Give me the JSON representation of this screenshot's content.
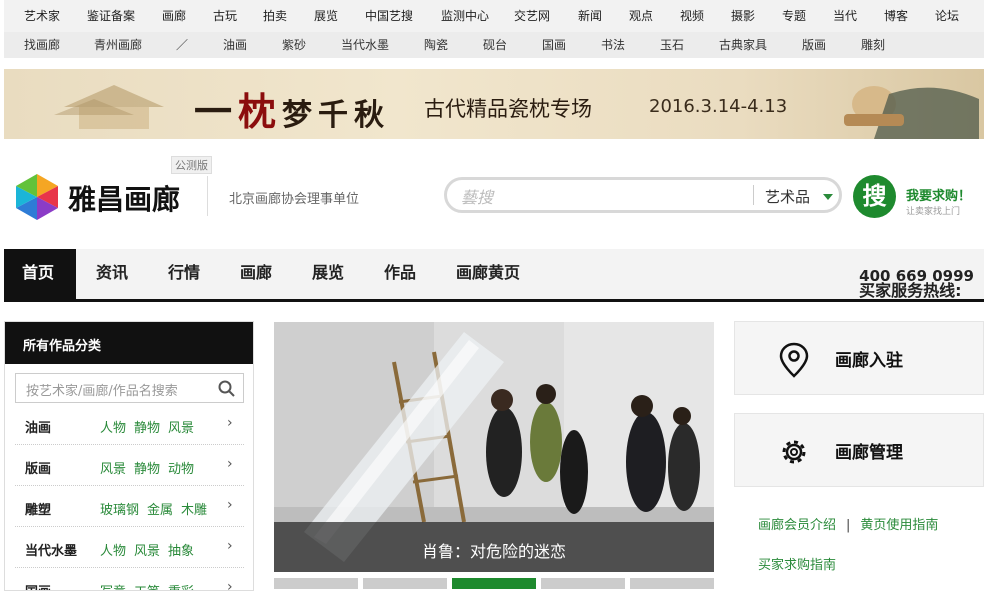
{
  "top_nav": [
    "艺术家",
    "鉴证备案",
    "画廊",
    "古玩",
    "拍卖",
    "展览",
    "中国艺搜",
    "监测中心",
    "交艺网",
    "新闻",
    "观点",
    "视频",
    "摄影",
    "专题",
    "当代",
    "博客",
    "论坛"
  ],
  "sub_nav": [
    "找画廊",
    "青州画廊",
    "／",
    "油画",
    "紫砂",
    "当代水墨",
    "陶瓷",
    "砚台",
    "国画",
    "书法",
    "玉石",
    "古典家具",
    "版画",
    "雕刻"
  ],
  "banner": {
    "title_a": "一",
    "title_red": "枕",
    "title_b": "梦千秋",
    "subtitle": "古代精品瓷枕专场",
    "dates": "2016.3.14-4.13"
  },
  "header": {
    "brand": "雅昌画廊",
    "beta": "公测版",
    "slogan": "北京画廊协会理事单位"
  },
  "search": {
    "placeholder": "藝搜",
    "category": "艺术品",
    "button": "搜",
    "want_buy": "我要求购！",
    "want_sub": "让卖家找上门"
  },
  "main_nav": {
    "items": [
      "首页",
      "资讯",
      "行情",
      "画廊",
      "展览",
      "作品",
      "画廊黄页"
    ],
    "hotline_label": "买家服务热线:",
    "hotline_number": "400 669 0999"
  },
  "categories": {
    "title": "所有作品分类",
    "search_placeholder": "按艺术家/画廊/作品名搜索",
    "rows": [
      {
        "name": "油画",
        "tags": [
          "人物",
          "静物",
          "风景"
        ]
      },
      {
        "name": "版画",
        "tags": [
          "风景",
          "静物",
          "动物"
        ]
      },
      {
        "name": "雕塑",
        "tags": [
          "玻璃钢",
          "金属",
          "木雕"
        ]
      },
      {
        "name": "当代水墨",
        "tags": [
          "人物",
          "风景",
          "抽象"
        ]
      },
      {
        "name": "国画",
        "tags": [
          "写意",
          "工笔",
          "重彩"
        ]
      }
    ]
  },
  "slider": {
    "caption": "肖鲁：对危险的迷恋",
    "active_index": 2,
    "count": 5
  },
  "side": {
    "join": "画廊入驻",
    "manage": "画廊管理",
    "link_member": "画廊会员介绍",
    "link_sep": "|",
    "link_guide": "黄页使用指南",
    "link_buyer": "买家求购指南"
  },
  "colors": {
    "accent_green": "#2a8a3a",
    "nav_dark": "#111111"
  }
}
